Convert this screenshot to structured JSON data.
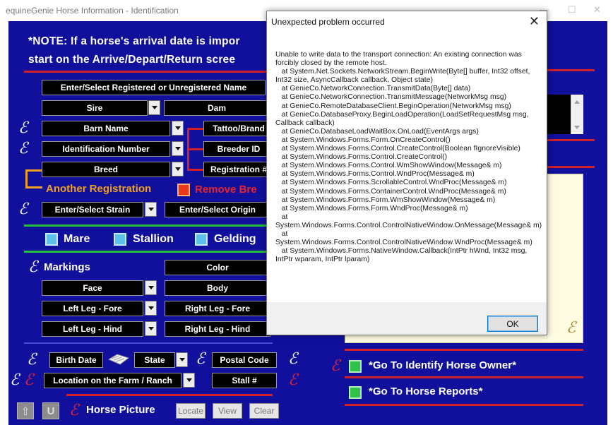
{
  "window": {
    "title": "equineGenie  Horse Information - Identification",
    "minimize": "—",
    "maximize": "☐",
    "close": "✕"
  },
  "note": {
    "line1": "*NOTE: If a horse's arrival date is impor",
    "line2": "start on the Arrive/Depart/Return scree"
  },
  "fields": {
    "name": "Enter/Select Registered or Unregistered Name",
    "sire": "Sire",
    "dam": "Dam",
    "barn_name": "Barn Name",
    "tattoo": "Tattoo/Brand",
    "id_number": "Identification Number",
    "breeder_id": "Breeder ID",
    "breed": "Breed",
    "registration": "Registration #",
    "strain": "Enter/Select Strain",
    "origin": "Enter/Select Origin",
    "color": "Color",
    "face": "Face",
    "body": "Body",
    "left_fore": "Left Leg - Fore",
    "right_fore": "Right Leg - Fore",
    "left_hind": "Left Leg - Hind",
    "right_hind": "Right Leg - Hind",
    "birth_date": "Birth Date",
    "state": "State",
    "postal_code": "Postal Code",
    "location": "Location on the Farm / Ranch",
    "stall": "Stall #"
  },
  "labels": {
    "another_registration": "Another Registration",
    "remove_breed": "Remove Bre",
    "mare": "Mare",
    "stallion": "Stallion",
    "gelding": "Gelding",
    "markings": "Markings",
    "horse_picture": "Horse Picture",
    "goto_owner": "*Go To Identify Horse Owner*",
    "goto_reports": "*Go To Horse Reports*"
  },
  "buttons": {
    "locate": "Locate",
    "view": "View",
    "clear": "Clear"
  },
  "icons": {
    "script_e": "ℰ",
    "up_arrow": "⇧",
    "u_icon": "U"
  },
  "dialog": {
    "title": "Unexpected problem occurred",
    "close": "✕",
    "message": "Unable to write data to the transport connection: An existing connection was forcibly closed by the remote host.\n   at System.Net.Sockets.NetworkStream.BeginWrite(Byte[] buffer, Int32 offset, Int32 size, AsyncCallback callback, Object state)\n   at GenieCo.NetworkConnection.TransmitData(Byte[] data)\n   at GenieCo.NetworkConnection.TransmitMessage(NetworkMsg msg)\n   at GenieCo.RemoteDatabaseClient.BeginOperation(NetworkMsg msg)\n   at GenieCo.DatabaseProxy.BeginLoadOperation(LoadSetRequestMsg msg, Callback callback)\n   at GenieCo.DatabaseLoadWaitBox.OnLoad(EventArgs args)\n   at System.Windows.Forms.Form.OnCreateControl()\n   at System.Windows.Forms.Control.CreateControl(Boolean fIgnoreVisible)\n   at System.Windows.Forms.Control.CreateControl()\n   at System.Windows.Forms.Control.WmShowWindow(Message& m)\n   at System.Windows.Forms.Control.WndProc(Message& m)\n   at System.Windows.Forms.ScrollableControl.WndProc(Message& m)\n   at System.Windows.Forms.ContainerControl.WndProc(Message& m)\n   at System.Windows.Forms.Form.WmShowWindow(Message& m)\n   at System.Windows.Forms.Form.WndProc(Message& m)\n   at\nSystem.Windows.Forms.Control.ControlNativeWindow.OnMessage(Message& m)\n   at\nSystem.Windows.Forms.Control.ControlNativeWindow.WndProc(Message& m)\n   at System.Windows.Forms.NativeWindow.Callback(IntPtr hWnd, Int32 msg, IntPtr wparam, IntPtr lparam)",
    "ok": "OK"
  },
  "colors": {
    "app_background": "#10109c",
    "accent_red": "#d0202a",
    "accent_green": "#27c23a",
    "accent_orange": "#f0a020"
  }
}
